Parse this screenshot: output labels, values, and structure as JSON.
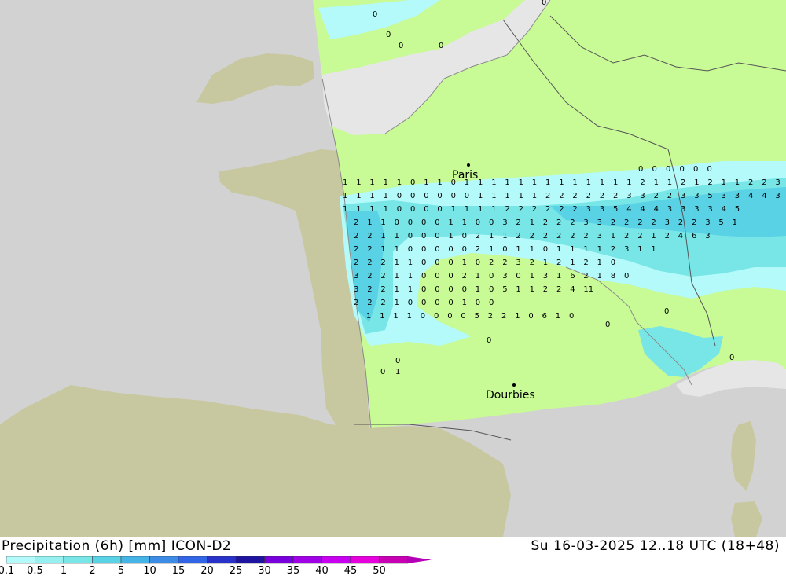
{
  "footer": {
    "product_title": "Precipitation (6h) [mm] ICON-D2",
    "valid_time": "Su 16-03-2025 12..18 UTC (18+48)"
  },
  "legend": {
    "ticks": [
      "0.1",
      "0.5",
      "1",
      "2",
      "5",
      "10",
      "15",
      "20",
      "25",
      "30",
      "35",
      "40",
      "45",
      "50"
    ],
    "colors": [
      "#b4fafa",
      "#96f0f0",
      "#78e6e6",
      "#5ad2e6",
      "#46b4e6",
      "#3c8ce6",
      "#3264e6",
      "#2832c8",
      "#1e14a0",
      "#7800dc",
      "#a000e6",
      "#c800f0",
      "#e600dc",
      "#c800b4"
    ]
  },
  "map": {
    "colors": {
      "sea": "#d2d2d2",
      "land_outside_domain": "#c8c8a0",
      "land_no_precip": "#c8fa96",
      "sea_in_domain": "#e6e6e6",
      "rain_light": "#b4fafa",
      "rain_moderate": "#78e6e6",
      "rain_heavier": "#5ad2e6"
    },
    "cities": [
      {
        "name": "Paris"
      },
      {
        "name": "Dourbies"
      }
    ],
    "value_rows": [
      "0 0 0 0 0 0",
      "1 1 1 1 1 0 1 1 0 1 1 1 1 1 1 1 1 1 1 1 1 1 2 1 1 2 1 2 1 1 2 2 3",
      "1 1 1 1 0 0 0 0 0 0 1 1 1 1 1 2 2 2 2 2 2 3 3 2 2 3 3 5 3 3 4 4 3 3",
      "1 1 1 1 0 0 0 0 1 1 1 1 2 2 2 2 2 2 3 3 5 4 4 4 3 3 3 3 4 5",
      "2 1 1 0 0 0 0 1 1 0 0 3 2 1 2 2 2 3 3 2 2 2 2 3 2 2 3 5 1",
      "2 2 1 1 0 0 0 1 0 2 1 1 2 2 2 2 2 2 3 1 2 2 1 2 4 6 3",
      "2 2 1 1 0 0 0 0 0 2 1 0 1 1 0 1 1 1 1 2 3 1 1",
      "2 2 2 1 1 0 0 0 1 0 2 2 3 2 1 2 1 2 1 0",
      "3 2 2 1 1 0 0 0 2 1 0 3 0 1 3 1 6 2 1 8 0",
      "3 2 2 1 1 0 0 0 0 1 0 5 1 1 2 2 4 11",
      "2 2 2 1 0 0 0 0 1 0 0",
      "1 1 1 1 0 0 0 0 5 2 2 1 0 6 1 0"
    ]
  }
}
